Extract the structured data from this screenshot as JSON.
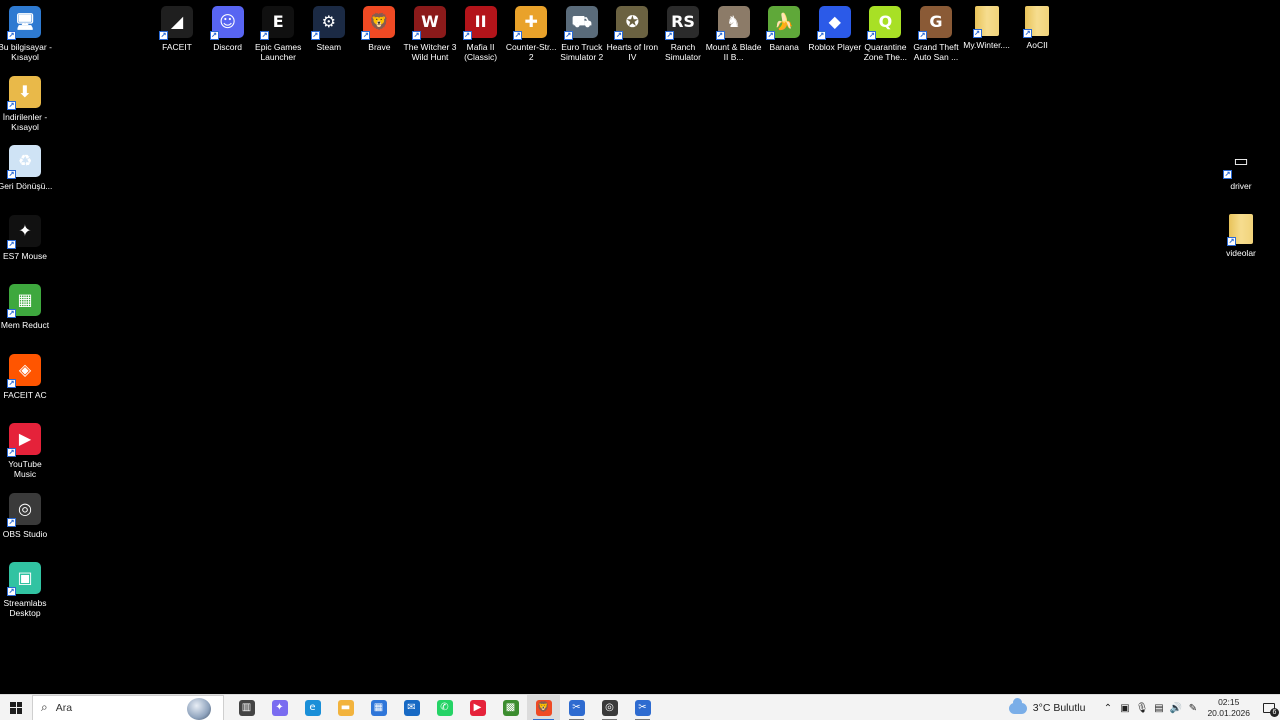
{
  "desktop_left": [
    {
      "name": "Bu bilgisayar - Kısayol",
      "icon": "computer-icon",
      "color": "#2e7ad1",
      "glyph": "🖥"
    },
    {
      "name": "İndirilenler - Kısayol",
      "icon": "downloads-folder-icon",
      "color": "#e9b949",
      "glyph": "⬇"
    },
    {
      "name": "Geri Dönüşü...",
      "icon": "recycle-bin-icon",
      "color": "#cfe3f5",
      "glyph": "♻"
    },
    {
      "name": "ES7 Mouse",
      "icon": "shuriken-icon",
      "color": "#111111",
      "glyph": "✦"
    },
    {
      "name": "Mem Reduct",
      "icon": "memory-icon",
      "color": "#3ea83e",
      "glyph": "▦"
    },
    {
      "name": "FACEIT AC",
      "icon": "faceit-ac-icon",
      "color": "#ff5500",
      "glyph": "◈"
    },
    {
      "name": "YouTube Music",
      "icon": "youtube-music-icon",
      "color": "#e5223a",
      "glyph": "▶"
    },
    {
      "name": "OBS Studio",
      "icon": "obs-icon",
      "color": "#3a3a3a",
      "glyph": "◎"
    },
    {
      "name": "Streamlabs Desktop",
      "icon": "streamlabs-icon",
      "color": "#31c3a2",
      "glyph": "▣"
    }
  ],
  "desktop_top": [
    {
      "name": "FACEIT",
      "icon": "faceit-icon",
      "color": "#1f1f1f",
      "glyph": "◢"
    },
    {
      "name": "Discord",
      "icon": "discord-icon",
      "color": "#5865f2",
      "glyph": "☺"
    },
    {
      "name": "Epic Games Launcher",
      "icon": "epic-games-icon",
      "color": "#101010",
      "glyph": "E"
    },
    {
      "name": "Steam",
      "icon": "steam-icon",
      "color": "#1b2a44",
      "glyph": "⚙"
    },
    {
      "name": "Brave",
      "icon": "brave-icon",
      "color": "#ef4a24",
      "glyph": "🦁"
    },
    {
      "name": "The Witcher 3 Wild Hunt",
      "icon": "witcher-icon",
      "color": "#8b1a1a",
      "glyph": "W"
    },
    {
      "name": "Mafia II (Classic)",
      "icon": "mafia-icon",
      "color": "#b3141a",
      "glyph": "II"
    },
    {
      "name": "Counter-Str... 2",
      "icon": "cs2-icon",
      "color": "#e9a22a",
      "glyph": "✚"
    },
    {
      "name": "Euro Truck Simulator 2",
      "icon": "ets2-icon",
      "color": "#5a6b7a",
      "glyph": "⛟"
    },
    {
      "name": "Hearts of Iron IV",
      "icon": "hoi4-icon",
      "color": "#6b6241",
      "glyph": "✪"
    },
    {
      "name": "Ranch Simulator",
      "icon": "ranch-icon",
      "color": "#2b2b2b",
      "glyph": "RS"
    },
    {
      "name": "Mount & Blade II B...",
      "icon": "bannerlord-icon",
      "color": "#8c7b68",
      "glyph": "♞"
    },
    {
      "name": "Banana",
      "icon": "banana-icon",
      "color": "#5fa839",
      "glyph": "🍌"
    },
    {
      "name": "Roblox Player",
      "icon": "roblox-icon",
      "color": "#2b5ae8",
      "glyph": "◆"
    },
    {
      "name": "Quarantine Zone The...",
      "icon": "quarantine-icon",
      "color": "#a8e025",
      "glyph": "Q"
    },
    {
      "name": "Grand Theft Auto San ...",
      "icon": "gta-sa-icon",
      "color": "#8a5a36",
      "glyph": "G"
    },
    {
      "name": "My.Winter....",
      "icon": "folder-icon",
      "color": "#f1d37a",
      "glyph": ""
    },
    {
      "name": "AoCII",
      "icon": "folder-icon",
      "color": "#f1d37a",
      "glyph": ""
    }
  ],
  "desktop_right": [
    {
      "name": "driver",
      "icon": "driver-icon",
      "color": "#000000",
      "glyph": "▭"
    },
    {
      "name": "videolar",
      "icon": "folder-icon",
      "color": "#f1d37a",
      "glyph": ""
    }
  ],
  "taskbar": {
    "search_placeholder": "Ara",
    "apps": [
      {
        "icon": "task-view-icon",
        "color": "#444444",
        "glyph": "▥",
        "state": ""
      },
      {
        "icon": "copilot-icon",
        "color": "#7a6cf0",
        "glyph": "✦",
        "state": ""
      },
      {
        "icon": "edge-icon",
        "color": "#1a8fd8",
        "glyph": "e",
        "state": ""
      },
      {
        "icon": "file-explorer-icon",
        "color": "#f2b33d",
        "glyph": "▬",
        "state": ""
      },
      {
        "icon": "microsoft-store-icon",
        "color": "#2f76d9",
        "glyph": "▦",
        "state": ""
      },
      {
        "icon": "outlook-icon",
        "color": "#1769c4",
        "glyph": "✉",
        "state": ""
      },
      {
        "icon": "whatsapp-icon",
        "color": "#25d366",
        "glyph": "✆",
        "state": ""
      },
      {
        "icon": "youtube-music-icon",
        "color": "#e5223a",
        "glyph": "▶",
        "state": ""
      },
      {
        "icon": "minecraft-icon",
        "color": "#3c8d2f",
        "glyph": "▩",
        "state": ""
      },
      {
        "icon": "brave-icon",
        "color": "#ef4a24",
        "glyph": "🦁",
        "state": "active"
      },
      {
        "icon": "snipping-tool-icon",
        "color": "#2e6bd0",
        "glyph": "✂",
        "state": "running"
      },
      {
        "icon": "obs-recording-icon",
        "color": "#3a3a3a",
        "glyph": "◎",
        "state": "running"
      },
      {
        "icon": "snipping-tool-icon-2",
        "color": "#2e6bd0",
        "glyph": "✂",
        "state": "running"
      }
    ],
    "weather": "3°C  Bulutlu",
    "time": "02:15",
    "date": "20.01.2026",
    "notification_count": "6"
  }
}
